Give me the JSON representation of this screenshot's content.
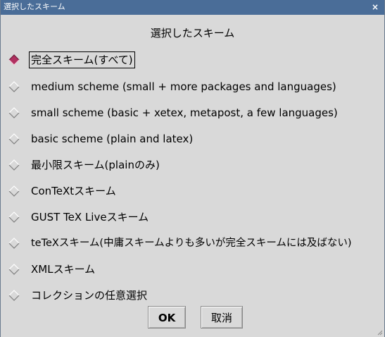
{
  "window": {
    "title": "選択したスキーム",
    "close_glyph": "×"
  },
  "heading": "選択したスキーム",
  "options": [
    {
      "label": "完全スキーム(すべて)",
      "selected": true
    },
    {
      "label": "medium scheme (small + more packages and languages)",
      "selected": false
    },
    {
      "label": "small scheme (basic + xetex, metapost, a few languages)",
      "selected": false
    },
    {
      "label": "basic scheme (plain and latex)",
      "selected": false
    },
    {
      "label": "最小限スキーム(plainのみ)",
      "selected": false
    },
    {
      "label": "ConTeXtスキーム",
      "selected": false
    },
    {
      "label": "GUST TeX Liveスキーム",
      "selected": false
    },
    {
      "label": "teTeXスキーム(中庸スキームよりも多いが完全スキームには及ばない)",
      "selected": false
    },
    {
      "label": "XMLスキーム",
      "selected": false
    },
    {
      "label": "コレクションの任意選択",
      "selected": false
    }
  ],
  "buttons": {
    "ok": "OK",
    "cancel": "取消"
  },
  "colors": {
    "titlebar": "#4a6d98",
    "background": "#d9d9d9",
    "radio_selected": "#b03060"
  }
}
